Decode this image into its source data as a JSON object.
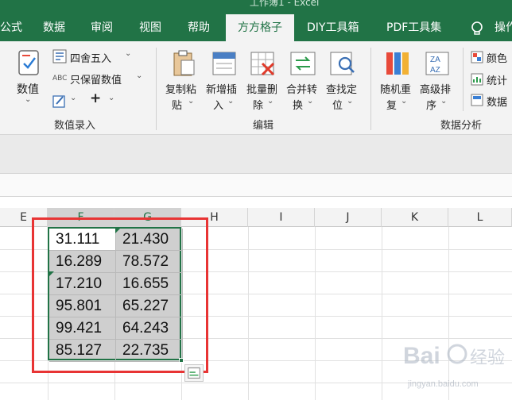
{
  "window": {
    "title_fragment": "工作簿1 - Excel"
  },
  "tabs": [
    {
      "label": "公式",
      "active": false
    },
    {
      "label": "数据",
      "active": false
    },
    {
      "label": "审阅",
      "active": false
    },
    {
      "label": "视图",
      "active": false
    },
    {
      "label": "帮助",
      "active": false
    },
    {
      "label": "方方格子",
      "active": true
    },
    {
      "label": "DIY工具箱",
      "active": false
    },
    {
      "label": "PDF工具集",
      "active": false
    },
    {
      "label": "操作",
      "active": false
    }
  ],
  "ribbon": {
    "value_entry": {
      "numeric_label": "数值",
      "round_label": "四舍五入",
      "keep_value_label": "只保留数值",
      "plus_label": "+",
      "group_label": "数值录入"
    },
    "edit": {
      "copy_paste": [
        "复制粘",
        "贴"
      ],
      "insert": [
        "新增插",
        "入"
      ],
      "batch_delete": [
        "批量删",
        "除"
      ],
      "merge_convert": [
        "合并转",
        "换"
      ],
      "find_locate": [
        "查找定",
        "位"
      ],
      "group_label": "编辑"
    },
    "analysis": {
      "random_repeat": [
        "随机重",
        "复"
      ],
      "advanced_sort": [
        "高级排",
        "序"
      ],
      "color_label": "颜色",
      "stats_label": "统计",
      "data_label": "数据",
      "group_label": "数据分析"
    }
  },
  "columns": [
    "E",
    "F",
    "G",
    "H",
    "I",
    "J",
    "K",
    "L"
  ],
  "selection": {
    "rows": [
      [
        "31.111",
        "21.430"
      ],
      [
        "16.289",
        "78.572"
      ],
      [
        "17.210",
        "16.655"
      ],
      [
        "95.801",
        "65.227"
      ],
      [
        "99.421",
        "64.243"
      ],
      [
        "85.127",
        "22.735"
      ]
    ]
  },
  "watermark": {
    "text": "jingyan.baidu.com"
  },
  "colors": {
    "excel_green": "#217346",
    "highlight_red": "#e83434",
    "selection_gray": "#cfcfcf"
  }
}
